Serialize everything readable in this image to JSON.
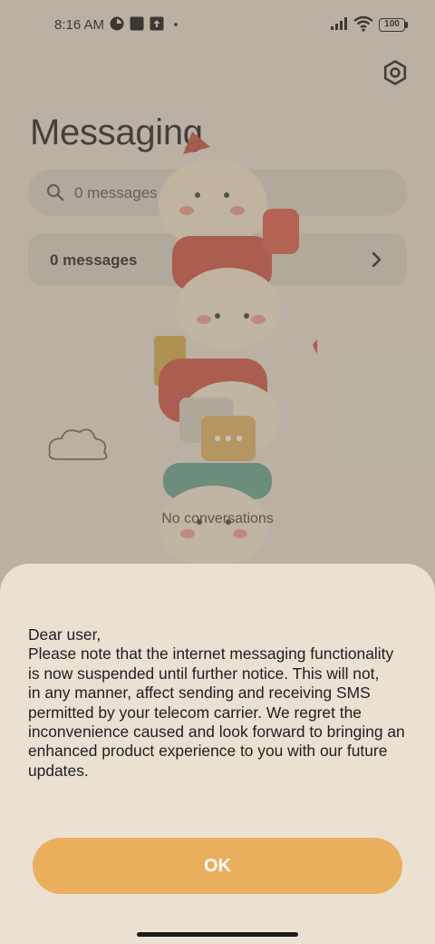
{
  "status_bar": {
    "time": "8:16 AM",
    "battery": "100",
    "icons": [
      "sync-icon",
      "square-notification-icon",
      "upload-icon",
      "dot-icon",
      "signal-icon",
      "wifi-icon",
      "battery-icon"
    ]
  },
  "header": {
    "title": "Messaging",
    "settings_icon": "settings-icon"
  },
  "search": {
    "placeholder": "0 messages"
  },
  "messages_card": {
    "label": "0 messages"
  },
  "empty_state": {
    "text": "No conversations"
  },
  "dialog": {
    "lines": [
      "Dear user,",
      "Please note that the internet messaging functionality",
      "is now suspended until further notice. This will not,",
      "in any manner, affect sending and receiving SMS",
      "permitted by your telecom carrier. We regret the",
      "inconvenience caused and look forward to bringing an",
      "enhanced product experience to you with our future",
      "updates."
    ],
    "ok_label": "OK"
  },
  "colors": {
    "background": "#eae1d3",
    "button": "#eaaf5d",
    "overlay": "#8a8174"
  }
}
